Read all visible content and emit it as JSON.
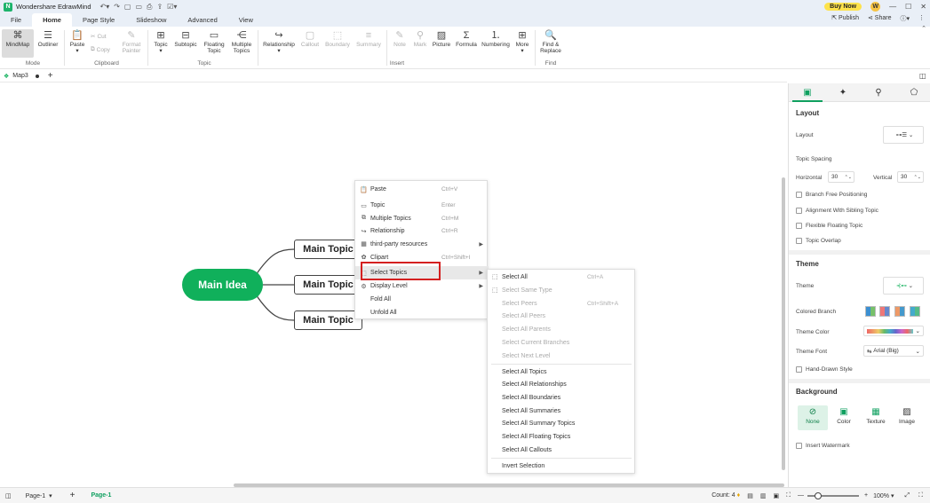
{
  "app": {
    "title": "Wondershare EdrawMind",
    "logo": "N"
  },
  "titlebar_right": {
    "buy_now": "Buy Now",
    "avatar": "W",
    "publish": "Publish",
    "share": "Share"
  },
  "menu_tabs": [
    "File",
    "Home",
    "Page Style",
    "Slideshow",
    "Advanced",
    "View"
  ],
  "ribbon": {
    "mode": {
      "mindmap": "MindMap",
      "outliner": "Outliner",
      "group": "Mode"
    },
    "clipboard": {
      "paste": "Paste",
      "cut": "Cut",
      "copy": "Copy",
      "format_painter_1": "Format",
      "format_painter_2": "Painter",
      "group": "Clipboard"
    },
    "topic": {
      "topic": "Topic",
      "subtopic": "Subtopic",
      "floating_1": "Floating",
      "floating_2": "Topic",
      "multiple_1": "Multiple",
      "multiple_2": "Topics",
      "group": "Topic"
    },
    "insert": {
      "relationship": "Relationship",
      "callout": "Callout",
      "boundary": "Boundary",
      "summary": "Summary",
      "note": "Note",
      "mark": "Mark",
      "picture": "Picture",
      "formula": "Formula",
      "numbering": "Numbering",
      "more": "More",
      "group": "Insert"
    },
    "find": {
      "find_1": "Find &",
      "find_2": "Replace",
      "group": "Find"
    }
  },
  "doc_tab": {
    "name": "Map3",
    "add": "+"
  },
  "mindmap": {
    "main_idea": "Main Idea",
    "topics": [
      "Main Topic",
      "Main Topic",
      "Main Topic"
    ]
  },
  "context_menu": [
    {
      "label": "Paste",
      "shortcut": "Ctrl+V",
      "icon": "📋"
    },
    {
      "label": "Topic",
      "shortcut": "Enter",
      "icon": "▭"
    },
    {
      "label": "Multiple Topics",
      "shortcut": "Ctrl+M",
      "icon": "⧉"
    },
    {
      "label": "Relationship",
      "shortcut": "Ctrl+R",
      "icon": "↪"
    },
    {
      "label": "third-party resources",
      "shortcut": "",
      "icon": "▦"
    },
    {
      "label": "Clipart",
      "shortcut": "Ctrl+Shift+I",
      "icon": "✿"
    },
    {
      "label": "Select Topics",
      "shortcut": "",
      "icon": "⬚"
    },
    {
      "label": "Display Level",
      "shortcut": "",
      "icon": "⚙"
    },
    {
      "label": "Fold All",
      "shortcut": "",
      "icon": ""
    },
    {
      "label": "Unfold All",
      "shortcut": "",
      "icon": ""
    }
  ],
  "submenu": [
    {
      "label": "Select All",
      "shortcut": "Ctrl+A"
    },
    {
      "label": "Select Same Type",
      "shortcut": ""
    },
    {
      "label": "Select Peers",
      "shortcut": "Ctrl+Shift+A"
    },
    {
      "label": "Select All Peers",
      "shortcut": ""
    },
    {
      "label": "Select All Parents",
      "shortcut": ""
    },
    {
      "label": "Select Current Branches",
      "shortcut": ""
    },
    {
      "label": "Select Next Level",
      "shortcut": ""
    },
    {
      "label": "Select All Topics",
      "shortcut": ""
    },
    {
      "label": "Select All Relationships",
      "shortcut": ""
    },
    {
      "label": "Select All Boundaries",
      "shortcut": ""
    },
    {
      "label": "Select All Summaries",
      "shortcut": ""
    },
    {
      "label": "Select All Summary Topics",
      "shortcut": ""
    },
    {
      "label": "Select All Floating Topics",
      "shortcut": ""
    },
    {
      "label": "Select All Callouts",
      "shortcut": ""
    },
    {
      "label": "Invert Selection",
      "shortcut": ""
    }
  ],
  "right_panel": {
    "layout_header": "Layout",
    "layout_label": "Layout",
    "topic_spacing": "Topic Spacing",
    "horizontal_label": "Horizontal",
    "horizontal_value": "30",
    "vertical_label": "Vertical",
    "vertical_value": "30",
    "checks_layout": [
      "Branch Free Positioning",
      "Alignment With Sibling Topic",
      "Flexible Floating Topic",
      "Topic Overlap"
    ],
    "theme_header": "Theme",
    "theme_label": "Theme",
    "colored_branch": "Colored Branch",
    "theme_color": "Theme Color",
    "theme_font": "Theme Font",
    "theme_font_value": "Arial (Big)",
    "hand_drawn": "Hand-Drawn Style",
    "background_header": "Background",
    "bg_options": [
      "None",
      "Color",
      "Texture",
      "Image"
    ],
    "insert_watermark": "Insert Watermark"
  },
  "status": {
    "page_select": "Page-1",
    "page_tab": "Page-1",
    "count": "Count: 4",
    "zoom": "100%"
  },
  "colors": {
    "accent": "#10b05b",
    "highlight_box": "#d42020",
    "buy_now": "#fde24b"
  }
}
